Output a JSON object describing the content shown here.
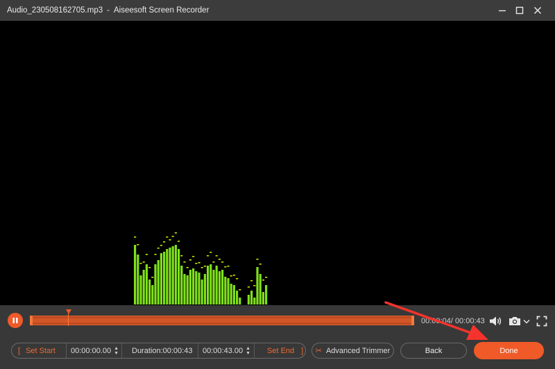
{
  "window": {
    "filename": "Audio_230508162705.mp3",
    "app_name": "Aiseesoft Screen Recorder",
    "separator": "-"
  },
  "visualizer": {
    "bar_color": "#7fe11a",
    "peak_color": "#d8f000"
  },
  "playback": {
    "current_time": "00:00:04",
    "total_time": "/ 00:00:43",
    "progress_fraction": 0.1,
    "accent_color": "#f05a28"
  },
  "icons": {
    "pause": "pause-icon",
    "volume": "volume-icon",
    "camera": "camera-icon",
    "fullscreen": "fullscreen-icon"
  },
  "trim": {
    "set_start_label": "Set Start",
    "start_time": "00:00:00.00",
    "duration_label": "Duration:00:00:43",
    "end_time": "00:00:43.00",
    "set_end_label": "Set End"
  },
  "buttons": {
    "advanced_trimmer": "Advanced Trimmer",
    "back": "Back",
    "done": "Done"
  }
}
